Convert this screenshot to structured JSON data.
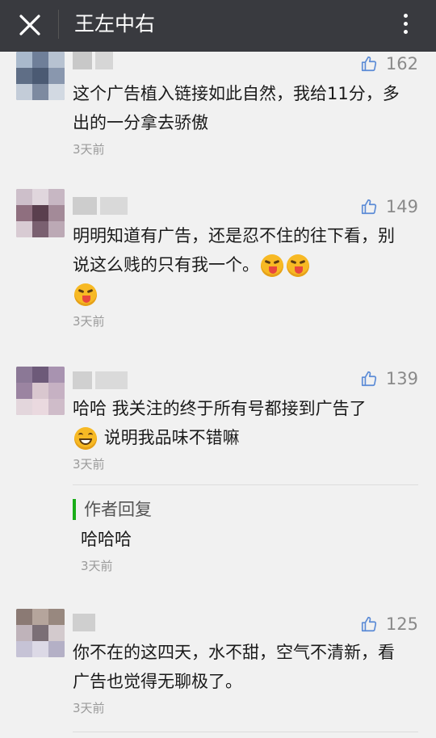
{
  "header": {
    "title": "王左中右",
    "close_icon": "close-icon",
    "more_icon": "more-vertical-icon"
  },
  "colors": {
    "header_bg": "#393a3f",
    "reply_accent": "#1aad19",
    "meta_text": "#9a9a9a"
  },
  "comments": [
    {
      "likes": "162",
      "text": "这个广告植入链接如此自然，我给11分，多出的一分拿去骄傲",
      "time": "3天前"
    },
    {
      "likes": "149",
      "text": "明明知道有广告，还是忍不住的往下看，别说这么贱的只有我一个。",
      "emoji": [
        "tongue-out-emoji",
        "tongue-out-emoji",
        "tongue-out-emoji"
      ],
      "time": "3天前"
    },
    {
      "likes": "139",
      "text_line1": "哈哈 我关注的终于所有号都接到广告了",
      "text_line2": "说明我品味不错嘛",
      "emoji": [
        "grin-emoji"
      ],
      "time": "3天前",
      "reply": {
        "label": "作者回复",
        "text": "哈哈哈",
        "time": "3天前"
      }
    },
    {
      "likes": "125",
      "text": "你不在的这四天，水不甜，空气不清新，看广告也觉得无聊极了。",
      "time": "3天前"
    }
  ]
}
